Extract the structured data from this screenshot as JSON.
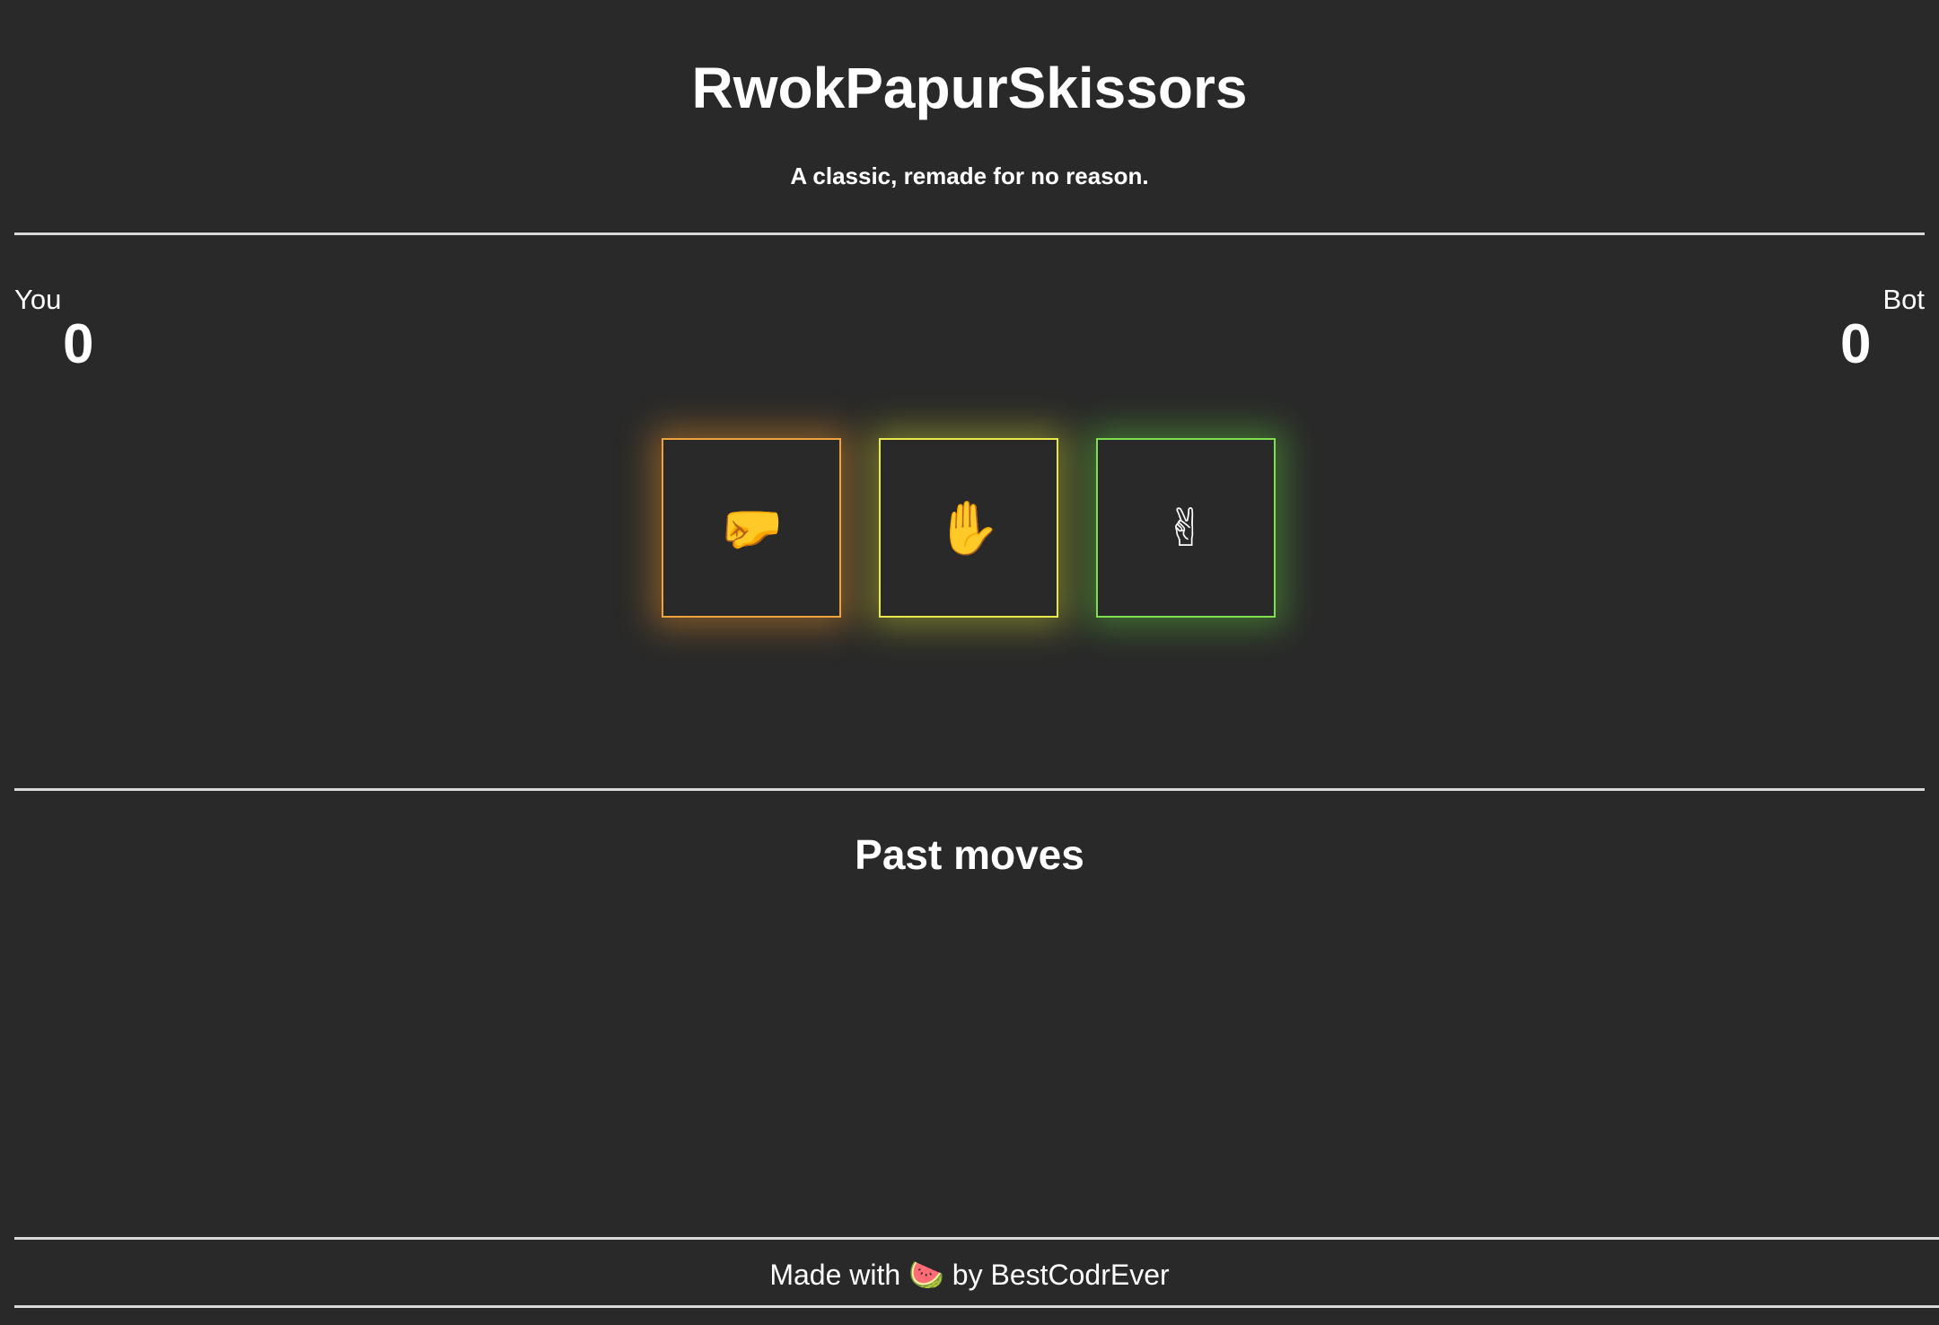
{
  "header": {
    "title": "RwokPapurSkissors",
    "subtitle": "A classic, remade for no reason."
  },
  "scoreboard": {
    "player": {
      "label": "You",
      "score": "0"
    },
    "bot": {
      "label": "Bot",
      "score": "0"
    }
  },
  "choices": [
    {
      "name": "rock",
      "icon": "fist-icon",
      "glyph": "🤛",
      "color": "#f0a23c"
    },
    {
      "name": "paper",
      "icon": "raised-hand-icon",
      "glyph": "✋",
      "color": "#e8e84a"
    },
    {
      "name": "scissors",
      "icon": "victory-hand-icon",
      "glyph": "✌",
      "color": "#7ee04e"
    }
  ],
  "past_moves": {
    "title": "Past moves",
    "items": []
  },
  "footer": {
    "prefix": "Made with",
    "icon": "watermelon-icon",
    "glyph": "🍉",
    "suffix": "by BestCodrEver"
  },
  "colors": {
    "background": "#292929",
    "text": "#ffffff",
    "rule": "#d9d9d9"
  }
}
